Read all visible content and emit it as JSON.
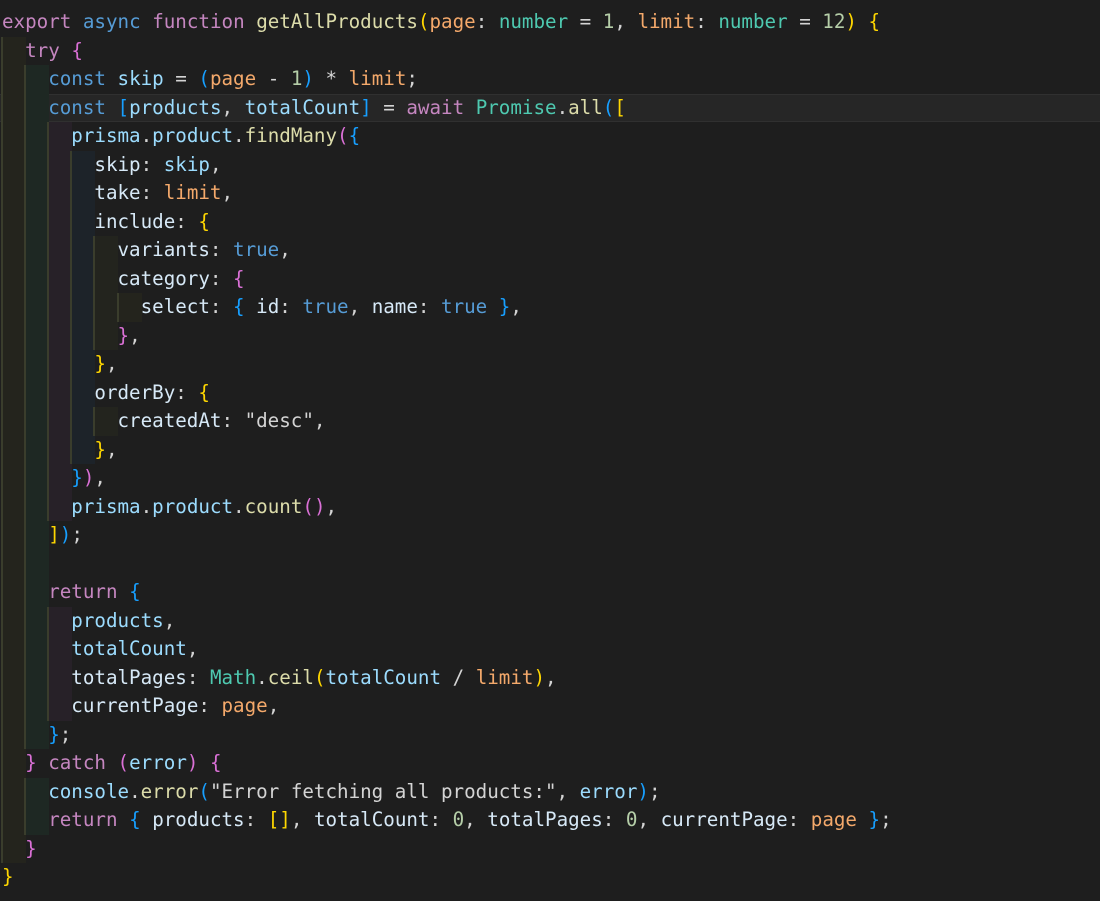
{
  "editor": {
    "colors": {
      "background": "#1e1e1e",
      "keyword_control": "#c586c0",
      "keyword_storage": "#569cd6",
      "function": "#dcdcaa",
      "type": "#4ec9b0",
      "parameter": "#f4a96b",
      "variable": "#9cdcfe",
      "bracket_1": "#ffd700",
      "bracket_2": "#da70d6",
      "bracket_3": "#179fff"
    },
    "current_line": 3,
    "lines": [
      {
        "indent": 0,
        "tokens": [
          [
            "kw",
            "export"
          ],
          [
            "op",
            " "
          ],
          [
            "kwb",
            "async"
          ],
          [
            "op",
            " "
          ],
          [
            "kw",
            "function"
          ],
          [
            "op",
            " "
          ],
          [
            "fn",
            "getAllProducts"
          ],
          [
            "b1",
            "("
          ],
          [
            "prm",
            "page"
          ],
          [
            "op",
            ": "
          ],
          [
            "type",
            "number"
          ],
          [
            "op",
            " = "
          ],
          [
            "num",
            "1"
          ],
          [
            "op",
            ", "
          ],
          [
            "prm",
            "limit"
          ],
          [
            "op",
            ": "
          ],
          [
            "type",
            "number"
          ],
          [
            "op",
            " = "
          ],
          [
            "num",
            "12"
          ],
          [
            "b1",
            ")"
          ],
          [
            "op",
            " "
          ],
          [
            "b1",
            "{"
          ]
        ]
      },
      {
        "indent": 1,
        "tokens": [
          [
            "kw",
            "try"
          ],
          [
            "op",
            " "
          ],
          [
            "b2",
            "{"
          ]
        ]
      },
      {
        "indent": 2,
        "tokens": [
          [
            "kwb",
            "const"
          ],
          [
            "op",
            " "
          ],
          [
            "var",
            "skip"
          ],
          [
            "op",
            " = "
          ],
          [
            "b3",
            "("
          ],
          [
            "prm",
            "page"
          ],
          [
            "op",
            " - "
          ],
          [
            "num",
            "1"
          ],
          [
            "b3",
            ")"
          ],
          [
            "op",
            " * "
          ],
          [
            "prm",
            "limit"
          ],
          [
            "op",
            ";"
          ]
        ]
      },
      {
        "indent": 2,
        "tokens": [
          [
            "kwb",
            "const"
          ],
          [
            "op",
            " "
          ],
          [
            "b3",
            "["
          ],
          [
            "var",
            "products"
          ],
          [
            "op",
            ", "
          ],
          [
            "var",
            "totalCount"
          ],
          [
            "b3",
            "]"
          ],
          [
            "op",
            " = "
          ],
          [
            "kw",
            "await"
          ],
          [
            "op",
            " "
          ],
          [
            "cls",
            "Promise"
          ],
          [
            "op",
            "."
          ],
          [
            "fn",
            "all"
          ],
          [
            "b3",
            "("
          ],
          [
            "b1",
            "["
          ]
        ]
      },
      {
        "indent": 3,
        "tokens": [
          [
            "var",
            "prisma"
          ],
          [
            "op",
            "."
          ],
          [
            "var",
            "product"
          ],
          [
            "op",
            "."
          ],
          [
            "fn",
            "findMany"
          ],
          [
            "b2",
            "("
          ],
          [
            "b3",
            "{"
          ]
        ]
      },
      {
        "indent": 4,
        "tokens": [
          [
            "prop",
            "skip"
          ],
          [
            "op",
            ": "
          ],
          [
            "var",
            "skip"
          ],
          [
            "op",
            ","
          ]
        ]
      },
      {
        "indent": 4,
        "tokens": [
          [
            "prop",
            "take"
          ],
          [
            "op",
            ": "
          ],
          [
            "prm",
            "limit"
          ],
          [
            "op",
            ","
          ]
        ]
      },
      {
        "indent": 4,
        "tokens": [
          [
            "prop",
            "include"
          ],
          [
            "op",
            ": "
          ],
          [
            "b1",
            "{"
          ]
        ]
      },
      {
        "indent": 5,
        "tokens": [
          [
            "prop",
            "variants"
          ],
          [
            "op",
            ": "
          ],
          [
            "kwb",
            "true"
          ],
          [
            "op",
            ","
          ]
        ]
      },
      {
        "indent": 5,
        "tokens": [
          [
            "prop",
            "category"
          ],
          [
            "op",
            ": "
          ],
          [
            "b2",
            "{"
          ]
        ]
      },
      {
        "indent": 6,
        "tokens": [
          [
            "prop",
            "select"
          ],
          [
            "op",
            ": "
          ],
          [
            "b3",
            "{"
          ],
          [
            "op",
            " "
          ],
          [
            "prop",
            "id"
          ],
          [
            "op",
            ": "
          ],
          [
            "kwb",
            "true"
          ],
          [
            "op",
            ", "
          ],
          [
            "prop",
            "name"
          ],
          [
            "op",
            ": "
          ],
          [
            "kwb",
            "true"
          ],
          [
            "op",
            " "
          ],
          [
            "b3",
            "}"
          ],
          [
            "op",
            ","
          ]
        ]
      },
      {
        "indent": 5,
        "tokens": [
          [
            "b2",
            "}"
          ],
          [
            "op",
            ","
          ]
        ]
      },
      {
        "indent": 4,
        "tokens": [
          [
            "b1",
            "}"
          ],
          [
            "op",
            ","
          ]
        ]
      },
      {
        "indent": 4,
        "tokens": [
          [
            "prop",
            "orderBy"
          ],
          [
            "op",
            ": "
          ],
          [
            "b1",
            "{"
          ]
        ]
      },
      {
        "indent": 5,
        "tokens": [
          [
            "prop",
            "createdAt"
          ],
          [
            "op",
            ": "
          ],
          [
            "str",
            "\"desc\""
          ],
          [
            "op",
            ","
          ]
        ]
      },
      {
        "indent": 4,
        "tokens": [
          [
            "b1",
            "}"
          ],
          [
            "op",
            ","
          ]
        ]
      },
      {
        "indent": 3,
        "tokens": [
          [
            "b3",
            "}"
          ],
          [
            "b2",
            ")"
          ],
          [
            "op",
            ","
          ]
        ]
      },
      {
        "indent": 3,
        "tokens": [
          [
            "var",
            "prisma"
          ],
          [
            "op",
            "."
          ],
          [
            "var",
            "product"
          ],
          [
            "op",
            "."
          ],
          [
            "fn",
            "count"
          ],
          [
            "b2",
            "("
          ],
          [
            "b2",
            ")"
          ],
          [
            "op",
            ","
          ]
        ]
      },
      {
        "indent": 2,
        "tokens": [
          [
            "b1",
            "]"
          ],
          [
            "b3",
            ")"
          ],
          [
            "op",
            ";"
          ]
        ]
      },
      {
        "indent": 2,
        "tokens": []
      },
      {
        "indent": 2,
        "tokens": [
          [
            "kw",
            "return"
          ],
          [
            "op",
            " "
          ],
          [
            "b3",
            "{"
          ]
        ]
      },
      {
        "indent": 3,
        "tokens": [
          [
            "var",
            "products"
          ],
          [
            "op",
            ","
          ]
        ]
      },
      {
        "indent": 3,
        "tokens": [
          [
            "var",
            "totalCount"
          ],
          [
            "op",
            ","
          ]
        ]
      },
      {
        "indent": 3,
        "tokens": [
          [
            "prop",
            "totalPages"
          ],
          [
            "op",
            ": "
          ],
          [
            "cls",
            "Math"
          ],
          [
            "op",
            "."
          ],
          [
            "fn",
            "ceil"
          ],
          [
            "b1",
            "("
          ],
          [
            "var",
            "totalCount"
          ],
          [
            "op",
            " / "
          ],
          [
            "prm",
            "limit"
          ],
          [
            "b1",
            ")"
          ],
          [
            "op",
            ","
          ]
        ]
      },
      {
        "indent": 3,
        "tokens": [
          [
            "prop",
            "currentPage"
          ],
          [
            "op",
            ": "
          ],
          [
            "prm",
            "page"
          ],
          [
            "op",
            ","
          ]
        ]
      },
      {
        "indent": 2,
        "tokens": [
          [
            "b3",
            "}"
          ],
          [
            "op",
            ";"
          ]
        ]
      },
      {
        "indent": 1,
        "tokens": [
          [
            "b2",
            "}"
          ],
          [
            "op",
            " "
          ],
          [
            "kw",
            "catch"
          ],
          [
            "op",
            " "
          ],
          [
            "b2",
            "("
          ],
          [
            "var",
            "error"
          ],
          [
            "b2",
            ")"
          ],
          [
            "op",
            " "
          ],
          [
            "b2",
            "{"
          ]
        ]
      },
      {
        "indent": 2,
        "tokens": [
          [
            "var",
            "console"
          ],
          [
            "op",
            "."
          ],
          [
            "fn",
            "error"
          ],
          [
            "b3",
            "("
          ],
          [
            "str",
            "\"Error fetching all products:\""
          ],
          [
            "op",
            ", "
          ],
          [
            "var",
            "error"
          ],
          [
            "b3",
            ")"
          ],
          [
            "op",
            ";"
          ]
        ]
      },
      {
        "indent": 2,
        "tokens": [
          [
            "kw",
            "return"
          ],
          [
            "op",
            " "
          ],
          [
            "b3",
            "{"
          ],
          [
            "op",
            " "
          ],
          [
            "prop",
            "products"
          ],
          [
            "op",
            ": "
          ],
          [
            "b1",
            "["
          ],
          [
            "b1",
            "]"
          ],
          [
            "op",
            ", "
          ],
          [
            "prop",
            "totalCount"
          ],
          [
            "op",
            ": "
          ],
          [
            "num",
            "0"
          ],
          [
            "op",
            ", "
          ],
          [
            "prop",
            "totalPages"
          ],
          [
            "op",
            ": "
          ],
          [
            "num",
            "0"
          ],
          [
            "op",
            ", "
          ],
          [
            "prop",
            "currentPage"
          ],
          [
            "op",
            ": "
          ],
          [
            "prm",
            "page"
          ],
          [
            "op",
            " "
          ],
          [
            "b3",
            "}"
          ],
          [
            "op",
            ";"
          ]
        ]
      },
      {
        "indent": 1,
        "tokens": [
          [
            "b2",
            "}"
          ]
        ]
      },
      {
        "indent": 0,
        "tokens": [
          [
            "b1",
            "}"
          ]
        ]
      }
    ]
  }
}
